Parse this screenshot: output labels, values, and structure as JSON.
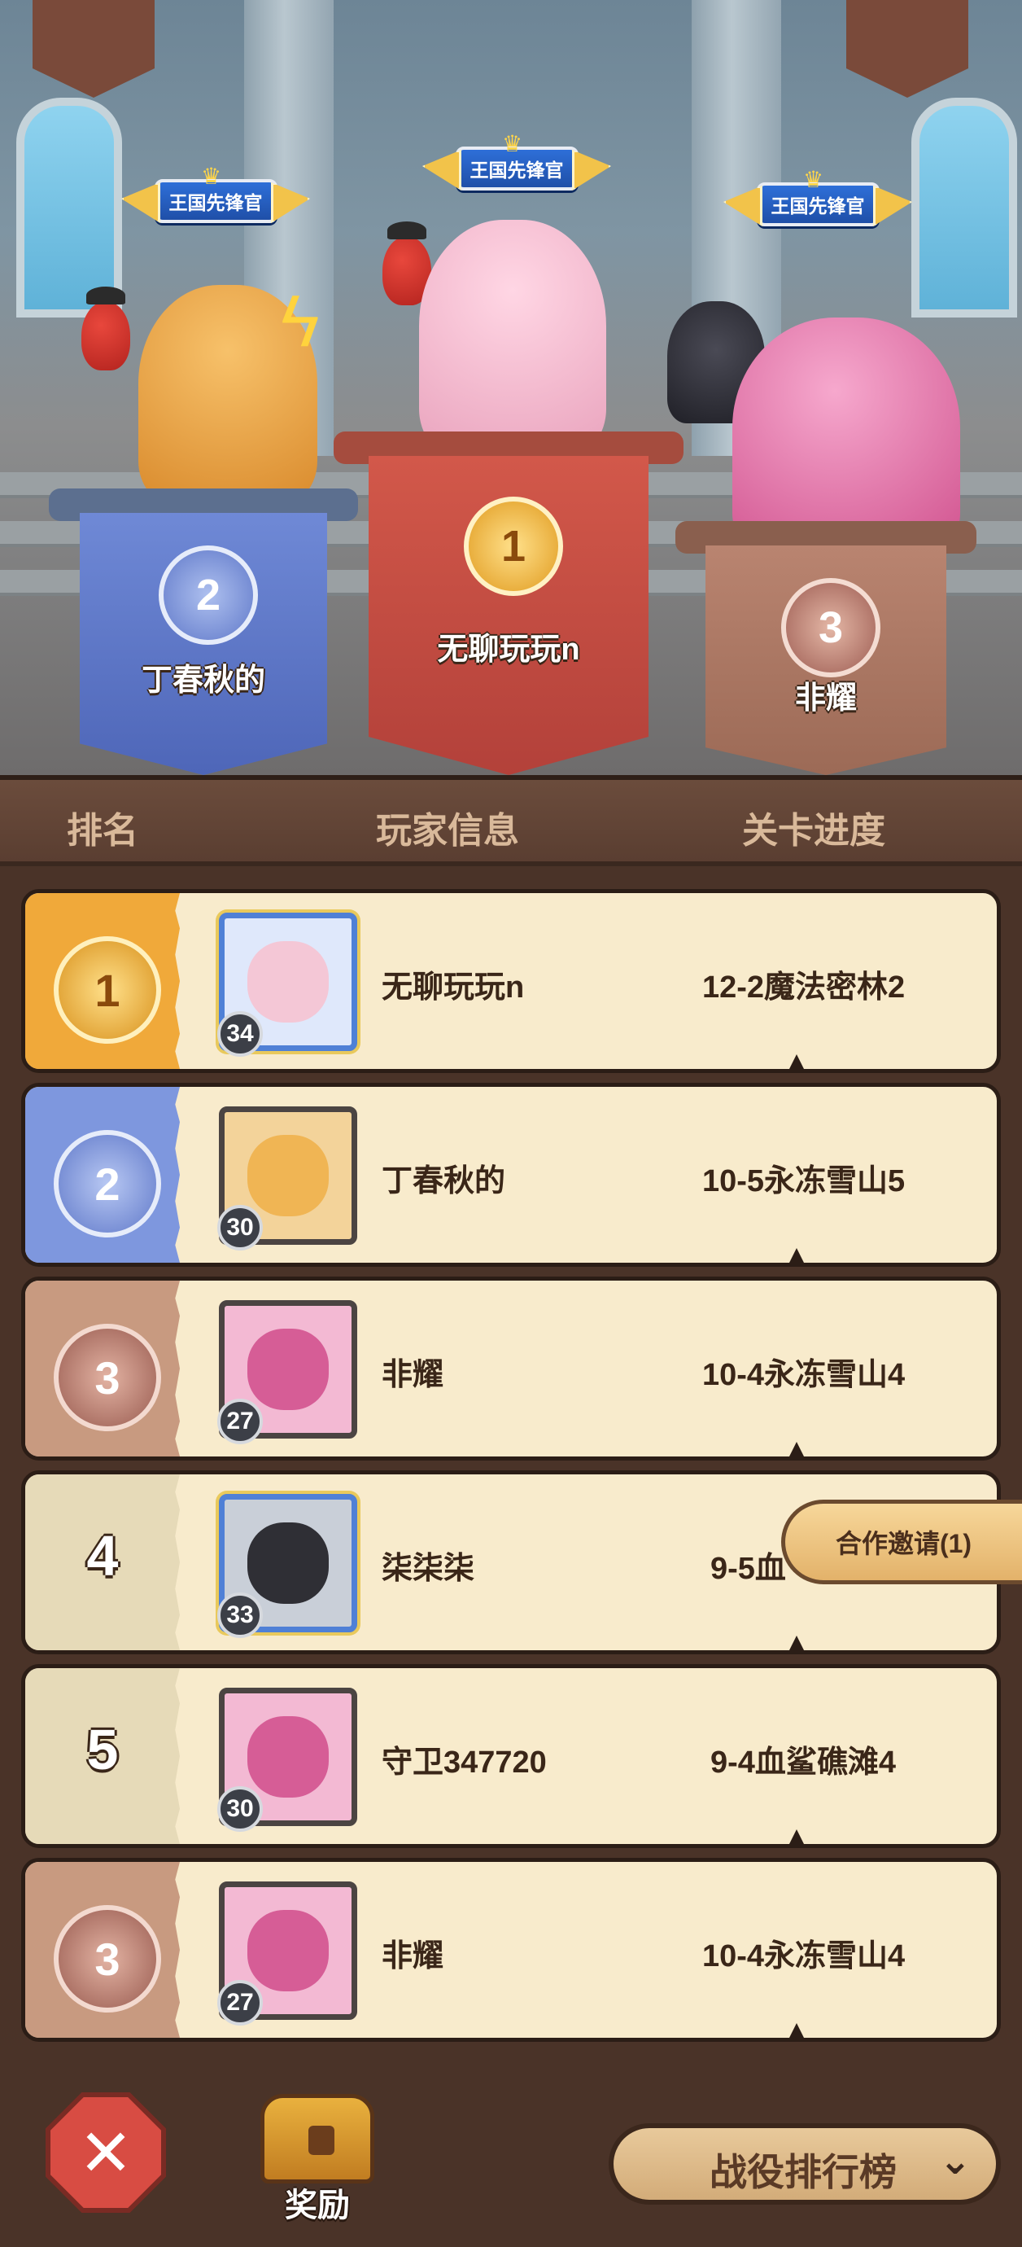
{
  "podium": {
    "title_badge": "王国先锋官",
    "first": {
      "rank": "1",
      "name": "无聊玩玩n"
    },
    "second": {
      "rank": "2",
      "name": "丁春秋的"
    },
    "third": {
      "rank": "3",
      "name": "非耀"
    }
  },
  "table_header": {
    "rank": "排名",
    "player": "玩家信息",
    "progress": "关卡进度"
  },
  "rows": [
    {
      "rank": "1",
      "level": "34",
      "name": "无聊玩玩n",
      "progress": "12-2魔法密林2"
    },
    {
      "rank": "2",
      "level": "30",
      "name": "丁春秋的",
      "progress": "10-5永冻雪山5"
    },
    {
      "rank": "3",
      "level": "27",
      "name": "非耀",
      "progress": "10-4永冻雪山4"
    },
    {
      "rank": "4",
      "level": "33",
      "name": "柒柒柒",
      "progress": "9-5血"
    },
    {
      "rank": "5",
      "level": "30",
      "name": "守卫347720",
      "progress": "9-4血鲨礁滩4"
    },
    {
      "rank": "3",
      "level": "27",
      "name": "非耀",
      "progress": "10-4永冻雪山4"
    }
  ],
  "coop_invite": "合作邀请(1)",
  "bottom": {
    "reward_label": "奖励",
    "selector_label": "战役排行榜",
    "selector_arrow": "⌄"
  },
  "colors": {
    "gold": "#f0a93a",
    "blue": "#7e97de",
    "bronze": "#c89a80",
    "plain": "#e6dab8",
    "row_bg": "#f8ebcc",
    "ink": "#3a2618"
  }
}
